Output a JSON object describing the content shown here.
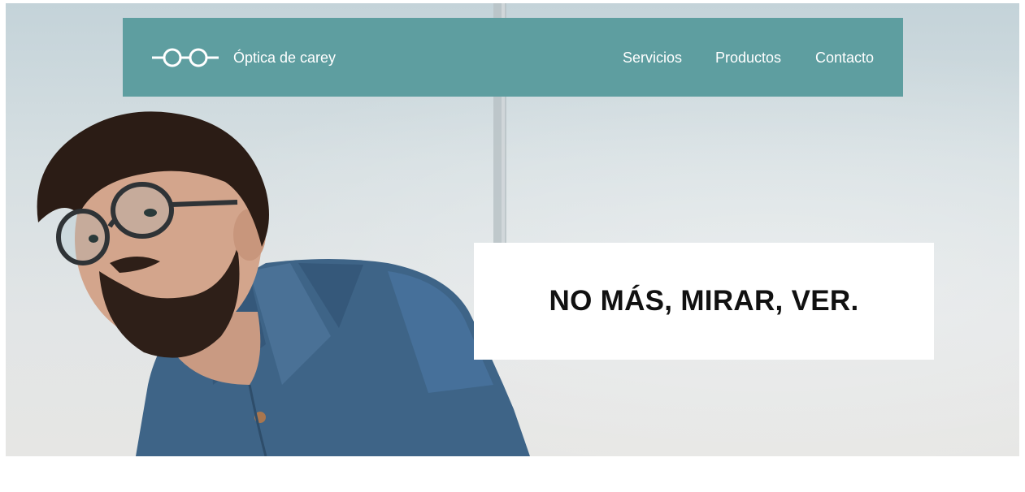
{
  "colors": {
    "navbar_bg": "#5e9ea0",
    "nav_text": "#ffffff",
    "tagline_bg": "#ffffff",
    "tagline_text": "#111111"
  },
  "header": {
    "logo_icon": "eyeglasses-icon",
    "brand": "Óptica de carey",
    "nav": [
      {
        "label": "Servicios"
      },
      {
        "label": "Productos"
      },
      {
        "label": "Contacto"
      }
    ]
  },
  "hero": {
    "image": "man-with-glasses-photo",
    "tagline": "NO MÁS, MIRAR, VER."
  }
}
